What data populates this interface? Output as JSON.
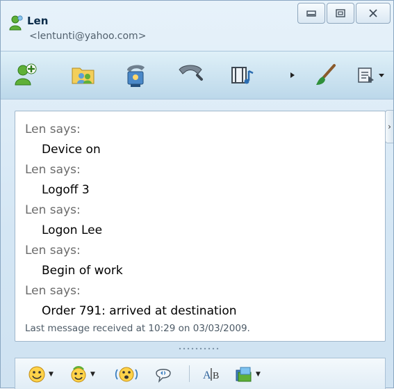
{
  "window": {
    "contact_name": "Len",
    "contact_email": "<lentunti@yahoo.com>",
    "controls": {
      "minimize": "minimize",
      "maximize": "maximize",
      "close": "close"
    }
  },
  "toolbar": {
    "icons": [
      "add-contact-icon",
      "share-folder-icon",
      "video-call-icon",
      "phone-call-icon",
      "media-icon",
      "more-chevron-icon",
      "background-brush-icon",
      "options-menu-icon"
    ]
  },
  "conversation": {
    "messages": [
      {
        "sender": "Len says:",
        "text": "Device on"
      },
      {
        "sender": "Len says:",
        "text": "Logoff 3"
      },
      {
        "sender": "Len says:",
        "text": "Logon Lee"
      },
      {
        "sender": "Len says:",
        "text": "Begin of work"
      },
      {
        "sender": "Len says:",
        "text": "Order 791: arrived at destination"
      }
    ],
    "last_received": "Last message received at 10:29 on 03/03/2009."
  },
  "input_toolbar": {
    "icons": [
      "emoticon-icon",
      "wink-icon",
      "nudge-icon",
      "voice-clip-icon",
      "font-icon",
      "background-icon"
    ]
  },
  "colors": {
    "accent": "#3b7fc0",
    "window_bg": "#d4e6f4",
    "sender": "#6b6b6b"
  }
}
